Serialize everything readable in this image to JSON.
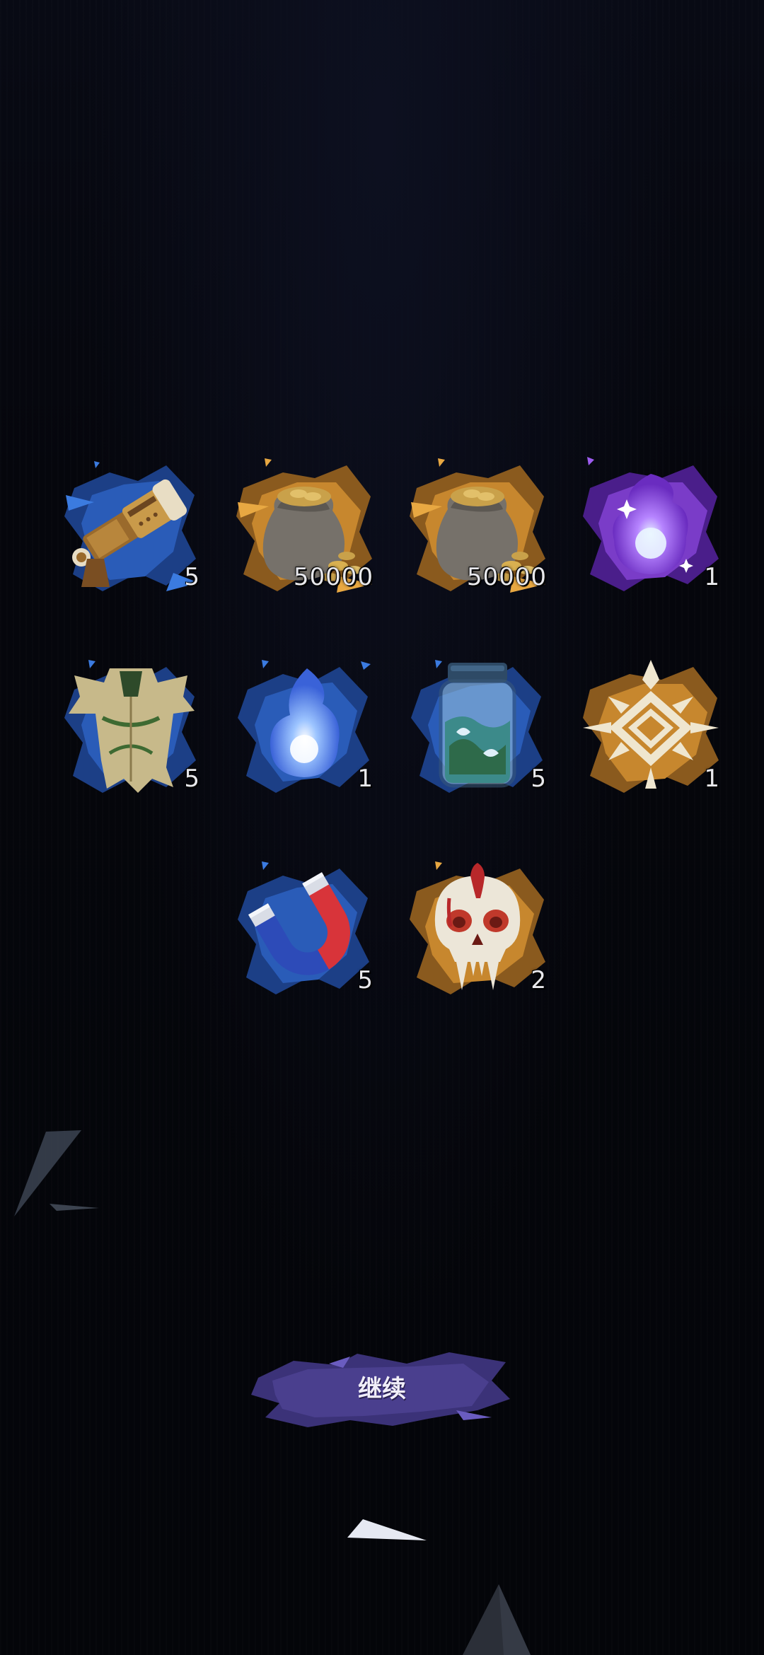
{
  "rewards": {
    "row1": [
      {
        "name": "Telescope",
        "icon": "telescope-icon",
        "count": "5",
        "frame_color": "#2a5cb8"
      },
      {
        "name": "Gold sack",
        "icon": "coin-bag-icon",
        "count": "50000",
        "frame_color": "#c7872e"
      },
      {
        "name": "Gold sack",
        "icon": "coin-bag-icon",
        "count": "50000",
        "frame_color": "#c7872e"
      },
      {
        "name": "Purple flame",
        "icon": "purple-flame-icon",
        "count": "1",
        "frame_color": "#7a3cc8"
      }
    ],
    "row2": [
      {
        "name": "Tattered robe",
        "icon": "robe-icon",
        "count": "5",
        "frame_color": "#2a5cb8"
      },
      {
        "name": "Blue flame",
        "icon": "blue-flame-icon",
        "count": "1",
        "frame_color": "#2a5cb8"
      },
      {
        "name": "Potion jar",
        "icon": "jar-icon",
        "count": "5",
        "frame_color": "#2a5cb8"
      },
      {
        "name": "Rune sigil",
        "icon": "rune-sigil-icon",
        "count": "1",
        "frame_color": "#c7872e"
      }
    ],
    "row3": [
      {
        "name": "Magnet",
        "icon": "magnet-icon",
        "count": "5",
        "frame_color": "#2a5cb8"
      },
      {
        "name": "Beast skull",
        "icon": "skull-icon",
        "count": "2",
        "frame_color": "#c7872e"
      }
    ]
  },
  "continue_button": {
    "label": "继续",
    "color": "#4a3f8e"
  },
  "colors": {
    "background": "#05060c",
    "count_text": "#e8e8ec"
  }
}
